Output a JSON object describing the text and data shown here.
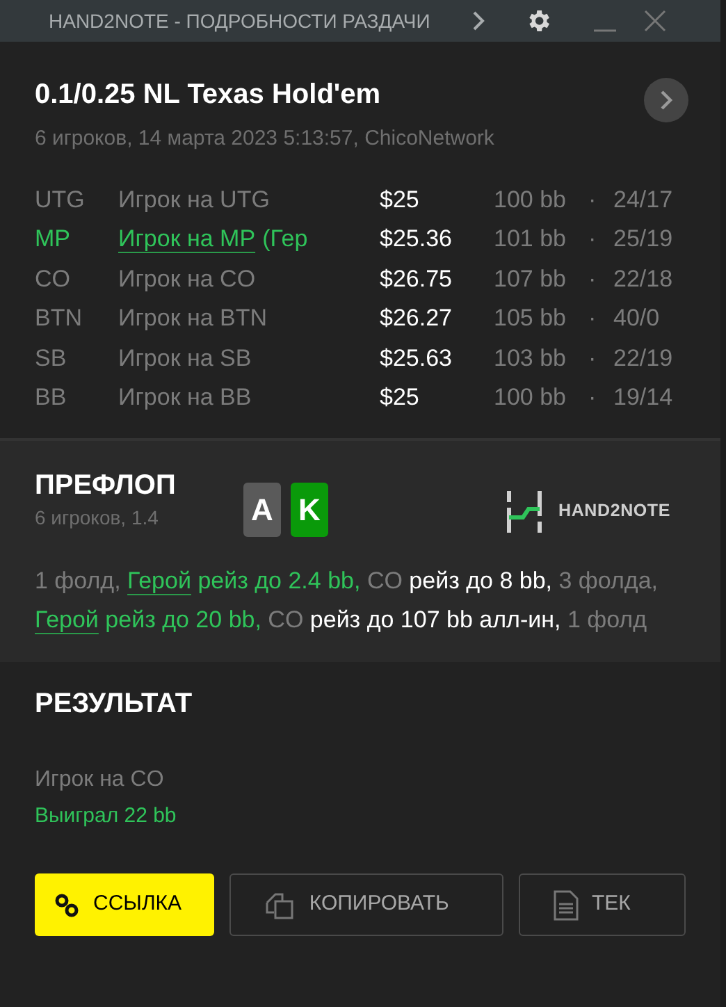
{
  "window": {
    "title": "HAND2NOTE - ПОДРОБНОСТИ РАЗДАЧИ"
  },
  "hand": {
    "title": "0.1/0.25 NL Texas Hold'em",
    "subtitle": "6 игроков, 14 марта 2023 5:13:57, ChicoNetwork"
  },
  "players": [
    {
      "position": "UTG",
      "name": "Игрок на UTG",
      "stack": "$25",
      "bb": "100 bb",
      "sep": "·",
      "hands": "24/17",
      "selected": false
    },
    {
      "position": "MP",
      "name": "Игрок на MP",
      "suffix": "(Гер",
      "stack": "$25.36",
      "bb": "101 bb",
      "sep": "·",
      "hands": "25/19",
      "selected": true
    },
    {
      "position": "CO",
      "name": "Игрок на CO",
      "stack": "$26.75",
      "bb": "107 bb",
      "sep": "·",
      "hands": "22/18",
      "selected": false
    },
    {
      "position": "BTN",
      "name": "Игрок на BTN",
      "stack": "$26.27",
      "bb": "105 bb",
      "sep": "·",
      "hands": "40/0",
      "selected": false
    },
    {
      "position": "SB",
      "name": "Игрок на SB",
      "stack": "$25.63",
      "bb": "103 bb",
      "sep": "·",
      "hands": "22/19",
      "selected": false
    },
    {
      "position": "BB",
      "name": "Игрок на BB",
      "stack": "$25",
      "bb": "100 bb",
      "sep": "·",
      "hands": "19/14",
      "selected": false
    }
  ],
  "preflop": {
    "title": "ПРЕФЛОП",
    "subtitle": "6 игроков, 1.4",
    "cards": [
      {
        "rank": "A",
        "color": "#5a5a5a"
      },
      {
        "rank": "K",
        "color": "#0a9a0a"
      }
    ],
    "logo": "HAND2NOTE",
    "actions": [
      {
        "kind": "muted",
        "text": "1 фолд, "
      },
      {
        "kind": "hero_link",
        "text": "Герой"
      },
      {
        "kind": "hero",
        "text": " рейз до 2.4 bb, "
      },
      {
        "kind": "muted",
        "text": "CO "
      },
      {
        "kind": "action",
        "text": "рейз до 8 bb, "
      },
      {
        "kind": "muted",
        "text": "3 фолда, "
      },
      {
        "kind": "hero_link",
        "text": "Герой"
      },
      {
        "kind": "hero",
        "text": " рейз до 20 bb, "
      },
      {
        "kind": "muted",
        "text": "CO "
      },
      {
        "kind": "action",
        "text": "рейз до 107 bb алл-ин, "
      },
      {
        "kind": "muted",
        "text": "1 фолд"
      }
    ]
  },
  "result": {
    "title": "РЕЗУЛЬТАТ",
    "winner": "Игрок на CO",
    "outcome": "Выиграл 22 bb"
  },
  "buttons": [
    {
      "kind": "link",
      "label": "ССЫЛКА"
    },
    {
      "kind": "copy",
      "label": "КОПИРОВАТЬ"
    },
    {
      "kind": "text",
      "label": "ТЕК"
    }
  ]
}
